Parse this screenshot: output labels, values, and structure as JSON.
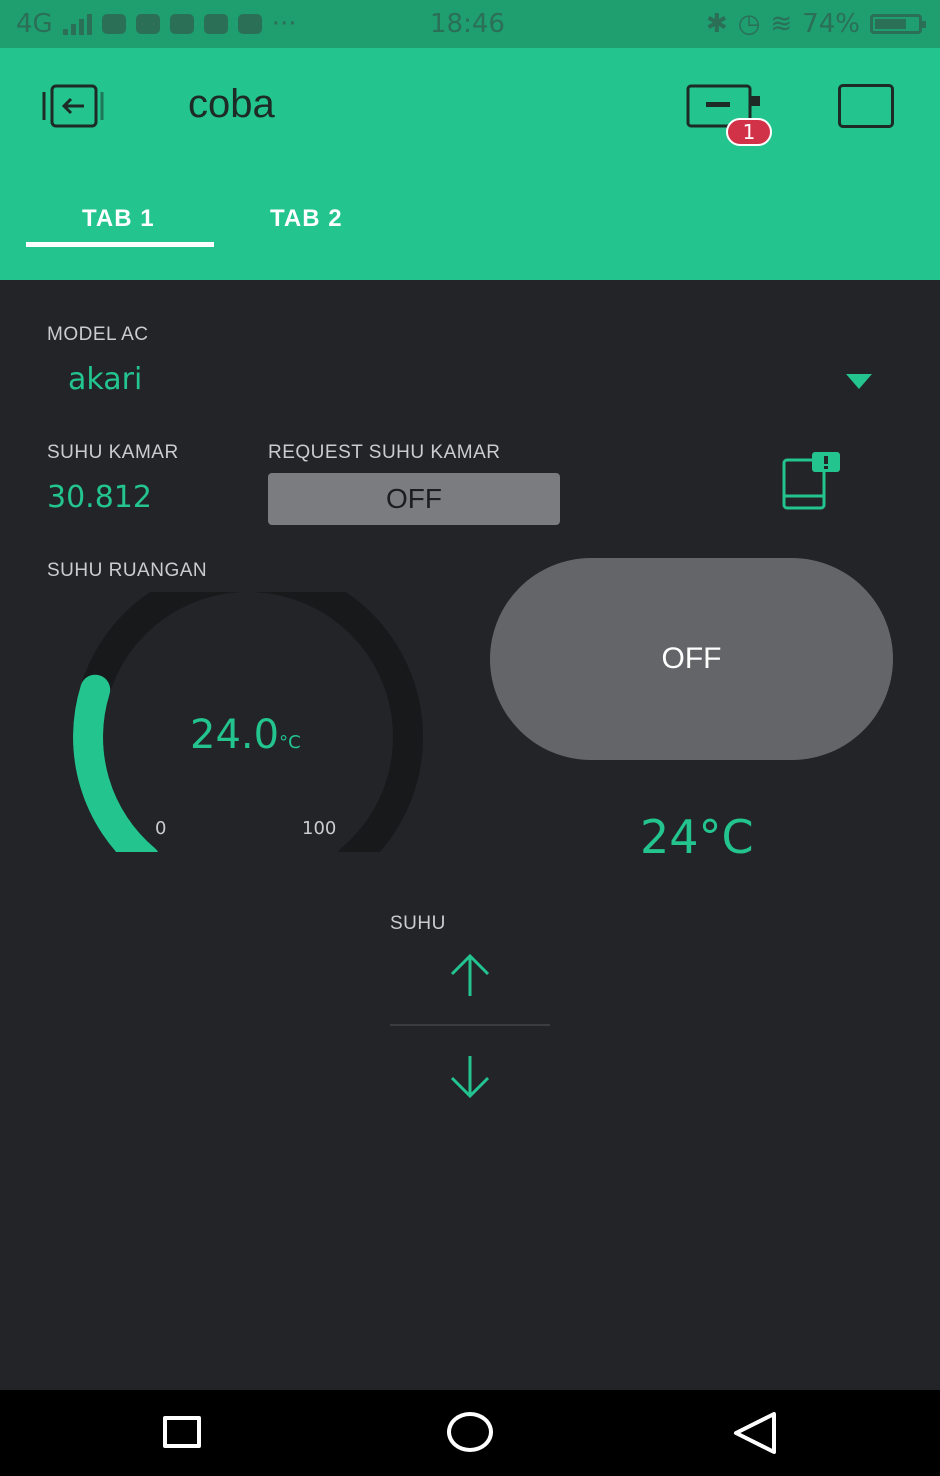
{
  "status_bar": {
    "network": "4G",
    "time": "18:46",
    "battery_text": "74%",
    "battery_level": 0.74,
    "notification_icons": [
      "youtube-icon",
      "twitter-icon",
      "app-icon",
      "instagram-icon",
      "mail-icon"
    ],
    "more": "···"
  },
  "header": {
    "title": "coba",
    "device_badge": "1",
    "tabs": [
      {
        "label": "TAB 1",
        "active": true
      },
      {
        "label": "TAB 2",
        "active": false
      }
    ]
  },
  "widgets": {
    "model_ac": {
      "label": "MODEL AC",
      "value": "akari"
    },
    "suhu_kamar": {
      "label": "SUHU KAMAR",
      "value": "30.812"
    },
    "request_suhu_kamar": {
      "label": "REQUEST SUHU KAMAR",
      "button": "OFF"
    },
    "suhu_ruangan": {
      "label": "SUHU RUANGAN",
      "value": "24.0",
      "unit": "°C",
      "min": "0",
      "max": "100",
      "level": 0.24
    },
    "power_button": {
      "label": "OFF"
    },
    "temperature_display": {
      "value": "24°C"
    },
    "step_control": {
      "label": "SUHU"
    }
  },
  "colors": {
    "accent": "#23c48e",
    "background": "#222427",
    "header": "#23c48e",
    "badge": "#d23248"
  },
  "nav_bar": {
    "icons": [
      "recent-apps-icon",
      "home-icon",
      "back-icon"
    ]
  }
}
